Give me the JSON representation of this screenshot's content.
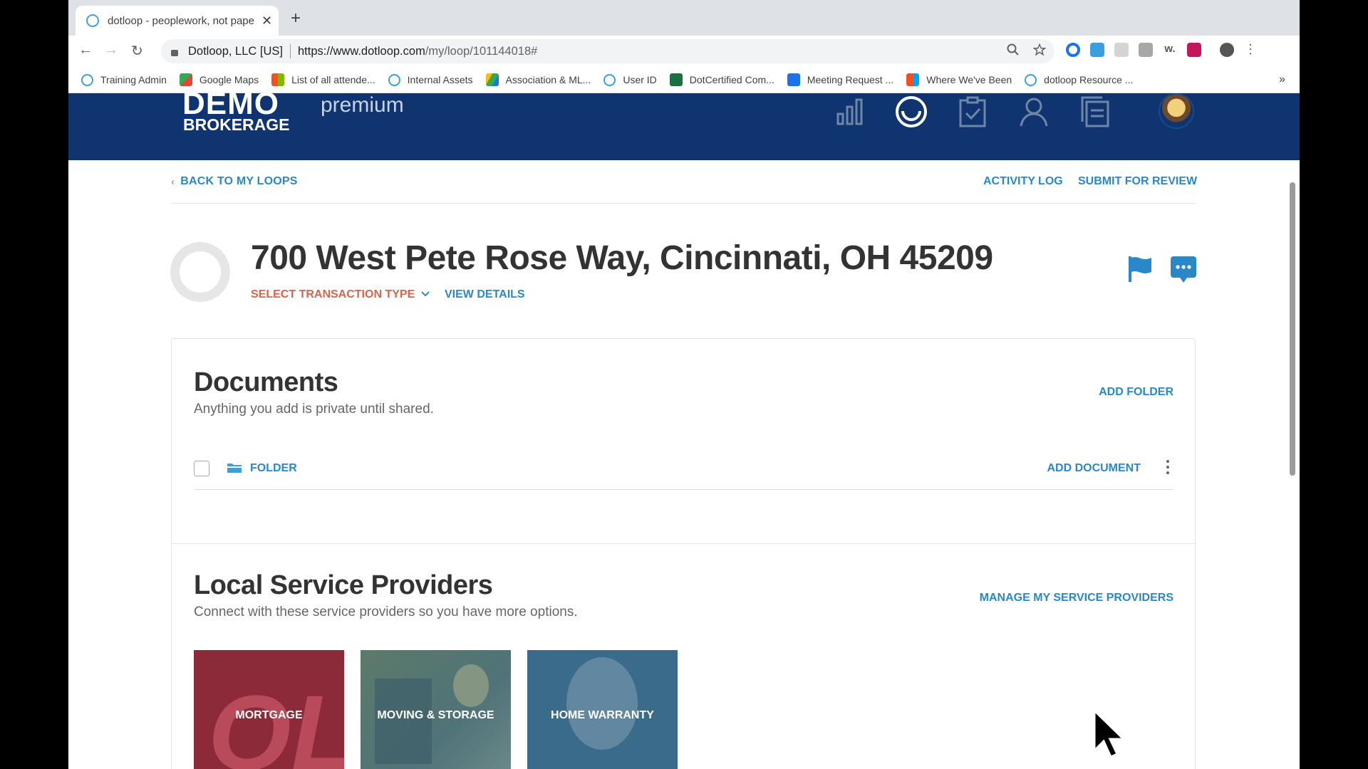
{
  "browser": {
    "tab_title": "dotloop - peoplework, not pape",
    "site_label": "Dotloop, LLC [US]",
    "url_host": "https://www.dotloop.com",
    "url_path": "/my/loop/101144018#",
    "bookmarks": [
      {
        "label": "Training Admin",
        "icon": "dotloop-ring-icon",
        "color": "#3aa0dd"
      },
      {
        "label": "Google Maps",
        "icon": "google-maps-icon",
        "color": "#34a853"
      },
      {
        "label": "List of all attende...",
        "icon": "microsoft-icon",
        "color": "#f25022"
      },
      {
        "label": "Internal Assets",
        "icon": "dotloop-ring-icon",
        "color": "#3aa0dd"
      },
      {
        "label": "Association & ML...",
        "icon": "google-drive-icon",
        "color": "#fbbc04"
      },
      {
        "label": "User ID",
        "icon": "dotloop-ring-icon",
        "color": "#3aa0dd"
      },
      {
        "label": "DotCertified Com...",
        "icon": "excel-icon",
        "color": "#1d6f42"
      },
      {
        "label": "Meeting Request ...",
        "icon": "calendar-app-icon",
        "color": "#1a73e8"
      },
      {
        "label": "Where We've Been",
        "icon": "microsoft-icon",
        "color": "#f25022"
      },
      {
        "label": "dotloop Resource ...",
        "icon": "dotloop-ring-icon",
        "color": "#3aa0dd"
      }
    ],
    "bookmarks_more": "»"
  },
  "header": {
    "logo_line1": "DEMO",
    "logo_line2": "BROKERAGE",
    "logo_tier": "premium"
  },
  "loop": {
    "back_label": "BACK TO MY LOOPS",
    "activity_log": "ACTIVITY LOG",
    "submit_review": "SUBMIT FOR REVIEW",
    "address": "700 West Pete Rose Way, Cincinnati, OH 45209",
    "transaction_type": "SELECT TRANSACTION TYPE",
    "view_details": "VIEW DETAILS"
  },
  "documents": {
    "title": "Documents",
    "subtitle": "Anything you add is private until shared.",
    "add_folder": "ADD FOLDER",
    "folder_label": "FOLDER",
    "add_document": "ADD DOCUMENT"
  },
  "providers": {
    "title": "Local Service Providers",
    "subtitle": "Connect with these service providers so you have more options.",
    "manage": "MANAGE MY SERVICE PROVIDERS",
    "tiles": [
      {
        "label": "MORTGAGE",
        "logo_text": "QL"
      },
      {
        "label": "MOVING & STORAGE"
      },
      {
        "label": "HOME WARRANTY"
      }
    ]
  },
  "colors": {
    "header_bg": "#0f3470",
    "link_blue": "#2a88c8",
    "accent_red": "#d9644a"
  }
}
